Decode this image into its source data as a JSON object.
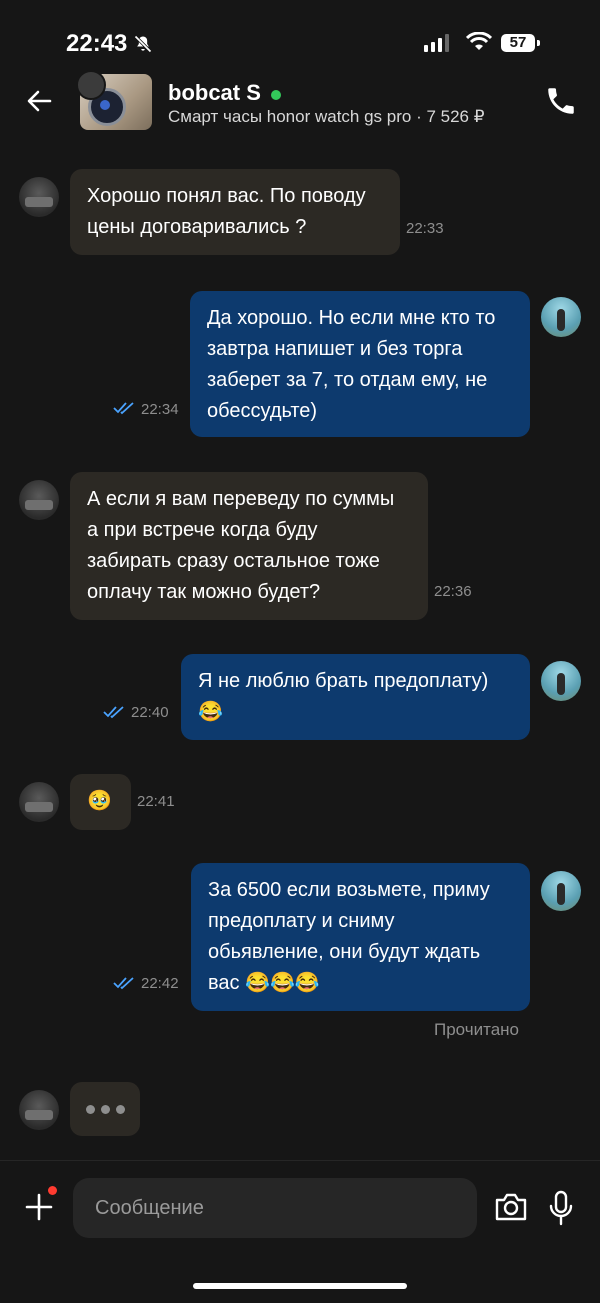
{
  "status_bar": {
    "time": "22:43",
    "battery": "57"
  },
  "header": {
    "contact_name": "bobcat S",
    "listing": "Смарт часы honor watch gs pro · 7 526 ₽"
  },
  "messages": [
    {
      "side": "in",
      "lines": [
        "Хорошо понял вас. По поводу",
        "цены договаривались ?"
      ],
      "time": "22:33"
    },
    {
      "side": "out",
      "lines": [
        "Да хорошо. Но если мне кто то",
        "завтра напишет и без торга",
        "заберет за 7, то отдам ему, не",
        "обессудьте)"
      ],
      "time": "22:34"
    },
    {
      "side": "in",
      "lines": [
        "А если я вам переведу по суммы",
        "а при встрече когда буду",
        "забирать сразу остальное тоже",
        "оплачу так можно будет?"
      ],
      "time": "22:36"
    },
    {
      "side": "out",
      "lines": [
        "Я не люблю брать предоплату)",
        "😂"
      ],
      "time": "22:40"
    },
    {
      "side": "in",
      "lines": [
        "🥹"
      ],
      "time": "22:41"
    },
    {
      "side": "out",
      "lines": [
        "За 6500 если возьмете, приму",
        "предоплату и сниму",
        "обьявление, они будут ждать",
        "вас 😂😂😂"
      ],
      "time": "22:42"
    }
  ],
  "read_status": "Прочитано",
  "input": {
    "placeholder": "Сообщение"
  },
  "colors": {
    "incoming": "#2c2924",
    "outgoing": "#0d3a6e",
    "check": "#4aa3ff",
    "online": "#33c95a"
  }
}
